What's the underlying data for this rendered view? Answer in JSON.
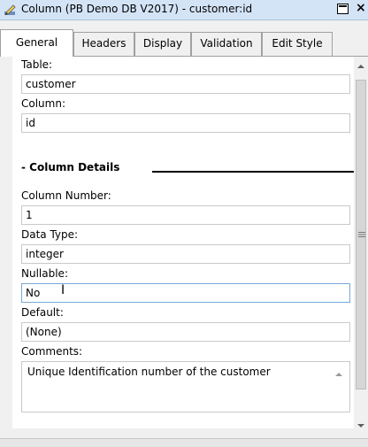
{
  "window": {
    "title": "Column (PB Demo DB V2017) - customer:id"
  },
  "tabs": [
    {
      "label": "General",
      "active": true
    },
    {
      "label": "Headers",
      "active": false
    },
    {
      "label": "Display",
      "active": false
    },
    {
      "label": "Validation",
      "active": false
    },
    {
      "label": "Edit Style",
      "active": false
    }
  ],
  "form": {
    "table_label": "Table:",
    "table_value": "customer",
    "column_label": "Column:",
    "column_value": "id",
    "section_title": "- Column Details",
    "column_number_label": "Column Number:",
    "column_number_value": "1",
    "data_type_label": "Data Type:",
    "data_type_value": "integer",
    "nullable_label": "Nullable:",
    "nullable_value": "No",
    "default_label": "Default:",
    "default_value": "(None)",
    "comments_label": "Comments:",
    "comments_value": "Unique Identification number of the customer"
  },
  "icons": {
    "window_icon": "pencil-icon",
    "restore": "restore-icon",
    "close": "close-icon",
    "scroll_up": "chevron-up-icon",
    "scroll_down": "chevron-down-icon",
    "scroll_grip": "grip-icon"
  }
}
